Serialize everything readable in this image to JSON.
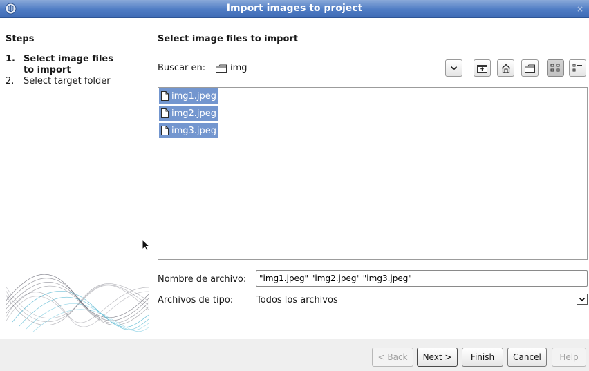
{
  "window": {
    "title": "Import images to project",
    "close_label": "×"
  },
  "steps": {
    "heading": "Steps",
    "items": [
      {
        "number": "1.",
        "line1": "Select image files",
        "line2": "to import",
        "active": true
      },
      {
        "number": "2.",
        "line1": "Select target folder",
        "line2": "",
        "active": false
      }
    ]
  },
  "content": {
    "heading": "Select image files to import",
    "look_in_label": "Buscar en:",
    "look_in_folder": "img"
  },
  "toolbar": {
    "icons": [
      "chevron-down-icon",
      "up-folder-icon",
      "home-icon",
      "new-folder-icon",
      "list-view-icon",
      "details-view-icon"
    ]
  },
  "files": [
    {
      "name": "img1.jpeg",
      "selected": true
    },
    {
      "name": "img2.jpeg",
      "selected": true
    },
    {
      "name": "img3.jpeg",
      "selected": true
    }
  ],
  "filename": {
    "label": "Nombre de archivo:",
    "value": "\"img1.jpeg\" \"img2.jpeg\" \"img3.jpeg\""
  },
  "filetype": {
    "label": "Archivos de tipo:",
    "value": "Todos los archivos"
  },
  "buttons": {
    "back": {
      "prefix": "< ",
      "mnemonic": "B",
      "rest": "ack",
      "enabled": false
    },
    "next": {
      "label": "Next >",
      "enabled": true
    },
    "finish": {
      "mnemonic": "F",
      "rest": "inish",
      "enabled": true
    },
    "cancel": {
      "label": "Cancel",
      "enabled": true
    },
    "help": {
      "mnemonic": "H",
      "rest": "elp",
      "enabled": false
    }
  },
  "colors": {
    "titlebar": "#4f7cc4",
    "selection": "#7396cf",
    "art_dark": "#4a4a5a",
    "art_teal": "#4fb3cf"
  }
}
